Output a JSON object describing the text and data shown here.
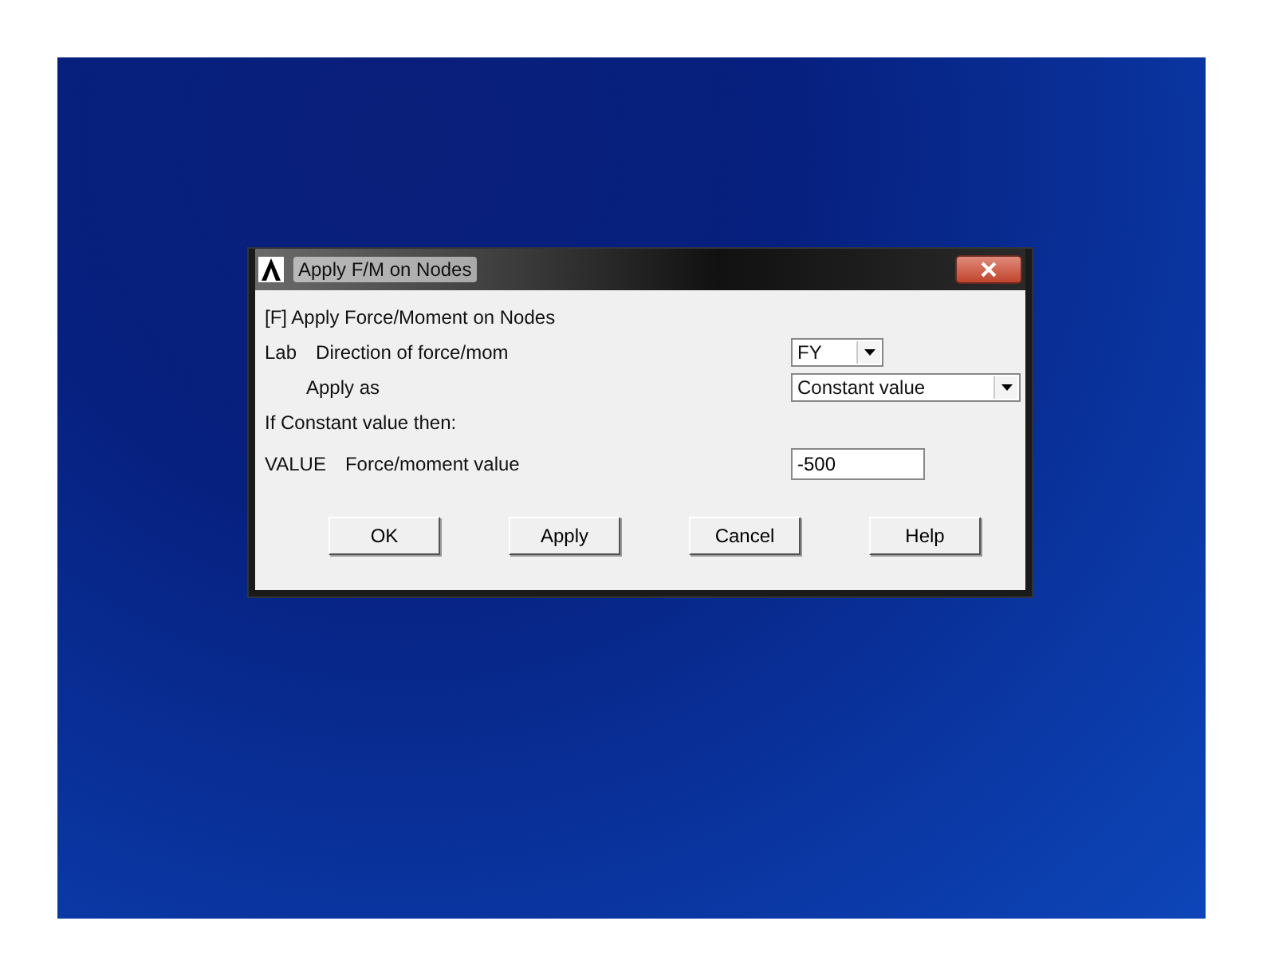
{
  "window": {
    "title": "Apply F/M on Nodes"
  },
  "heading": "[F]  Apply Force/Moment on Nodes",
  "fields": [
    {
      "kind": "dropdown",
      "code": "Lab",
      "label": "Direction of force/mom",
      "value": "FY",
      "wide": false
    },
    {
      "kind": "dropdown",
      "label": "Apply as",
      "value": "Constant value",
      "wide": true
    },
    {
      "kind": "note",
      "label": "If Constant value then:"
    },
    {
      "kind": "text",
      "code": "VALUE",
      "label": "Force/moment value",
      "value": "-500"
    }
  ],
  "buttons": [
    "OK",
    "Apply",
    "Cancel",
    "Help"
  ]
}
